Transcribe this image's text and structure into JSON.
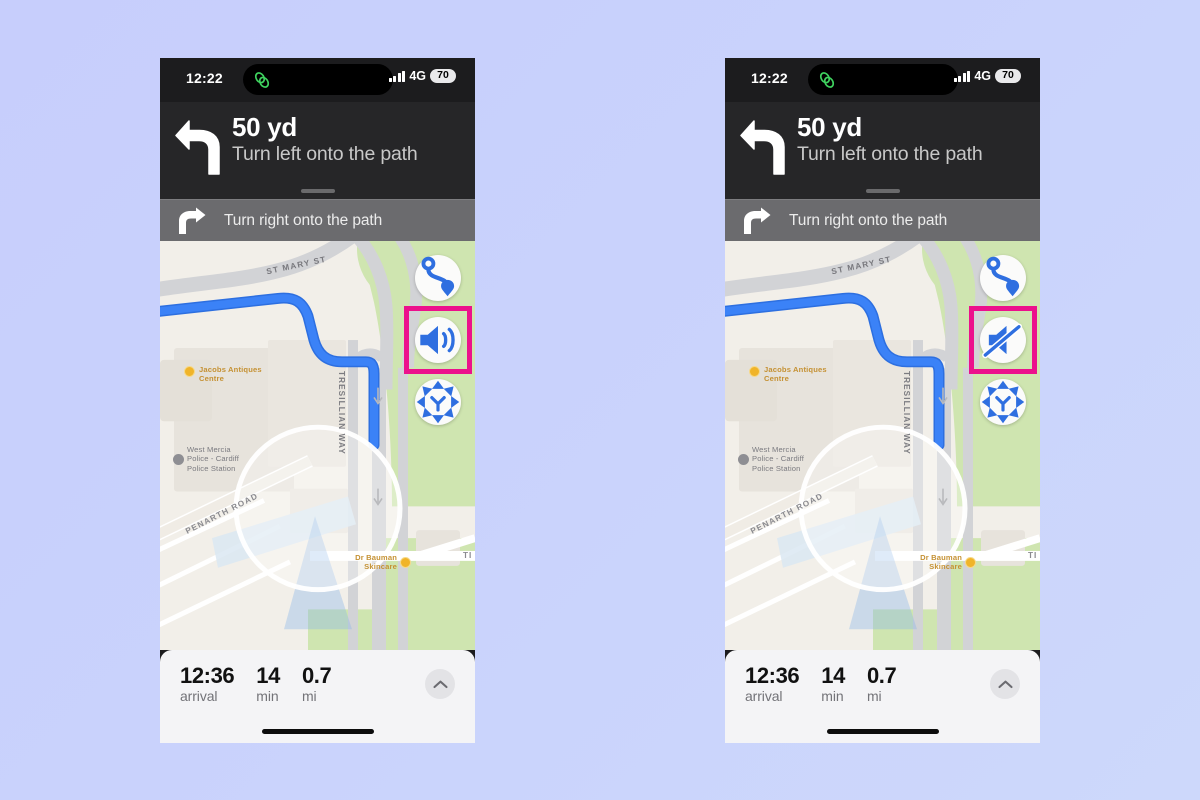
{
  "background_color": "#c9d2fc",
  "highlight_color": "#ec118c",
  "phones": [
    {
      "id": "left",
      "sound_state": "unmuted",
      "sound_icon": "speaker-wave-icon"
    },
    {
      "id": "right",
      "sound_state": "muted",
      "sound_icon": "speaker-slash-icon"
    }
  ],
  "status_bar": {
    "time": "12:22",
    "island_icon": "facetime-link-icon",
    "network": "4G",
    "battery": "70",
    "signal_icon": "cellular-bars-icon"
  },
  "maneuver": {
    "icon": "turn-left-arrow-icon",
    "distance": "50 yd",
    "instruction": "Turn left onto the path"
  },
  "next_step": {
    "icon": "turn-right-arrow-icon",
    "instruction": "Turn right onto the path"
  },
  "map_controls": [
    {
      "name": "route-overview-button",
      "icon": "route-overview-icon"
    },
    {
      "name": "sound-toggle-button",
      "icon": "speaker-wave-icon"
    },
    {
      "name": "recenter-3d-button",
      "icon": "compass-expand-icon"
    }
  ],
  "map_labels": {
    "street_top": "ST MARY ST",
    "street_vertical": "TRESILLIAN WAY",
    "street_bottom": "PENARTH ROAD",
    "street_right_edge": "TI",
    "poi_antiques": "Jacobs Antiques Centre",
    "poi_antiques_line1": "Jacobs Antiques",
    "poi_antiques_line2": "Centre",
    "poi_police_line1": "West Mercia",
    "poi_police_line2": "Police - Cardiff",
    "poi_police_line3": "Police Station",
    "poi_skincare_line1": "Dr Bauman",
    "poi_skincare_line2": "Skincare",
    "route_color": "#3b7ff5",
    "park_color": "#cfe5b0",
    "road_color": "#d2d3d6",
    "land_color": "#f2efe9"
  },
  "bottom_sheet": {
    "items": [
      {
        "value": "12:36",
        "label": "arrival"
      },
      {
        "value": "14",
        "label": "min"
      },
      {
        "value": "0.7",
        "label": "mi"
      }
    ],
    "expand_icon": "chevron-up-icon"
  }
}
